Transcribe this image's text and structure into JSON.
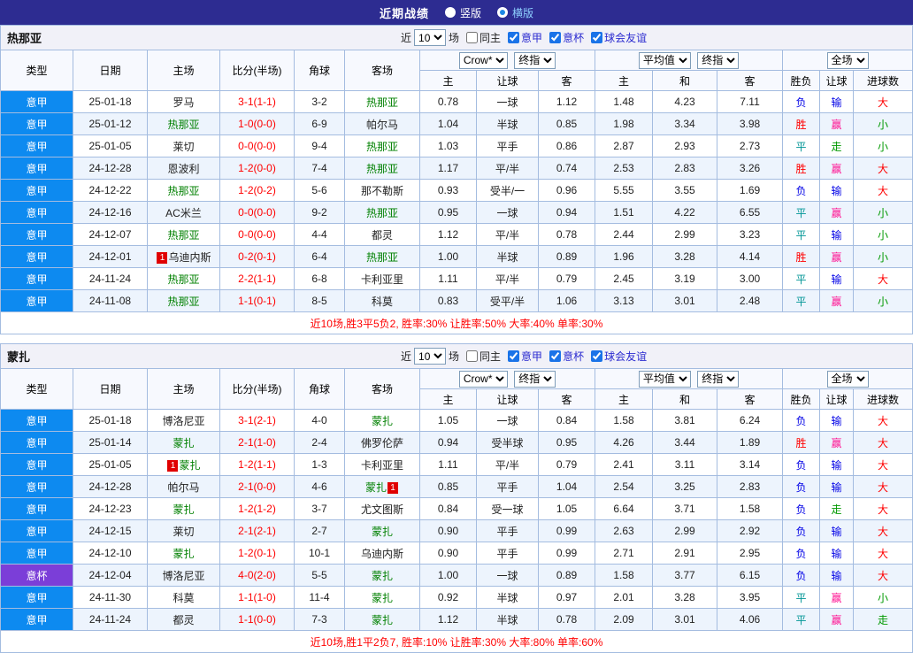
{
  "topbar": {
    "title": "近期战绩",
    "options": [
      {
        "label": "竖版",
        "selected": false
      },
      {
        "label": "横版",
        "selected": true
      }
    ]
  },
  "ui": {
    "recent_label": "近",
    "count_value": "10",
    "matches_label": "场"
  },
  "columns": {
    "type": "类型",
    "date": "日期",
    "home": "主场",
    "score": "比分(半场)",
    "corner": "角球",
    "away": "客场",
    "bookmaker_select": "Crow*",
    "final_select": "终指",
    "average_select": "平均值",
    "fulltime_select": "全场",
    "sub_home1": "主",
    "sub_handicap1": "让球",
    "sub_away1": "客",
    "sub_home2": "主",
    "sub_draw": "和",
    "sub_away2": "客",
    "sub_winlose": "胜负",
    "sub_handicap2": "让球",
    "sub_goals": "进球数"
  },
  "colors": {
    "topbar_bg": "#2d2c91",
    "league_badge_blue": "#0d8af0",
    "cup_badge_purple": "#7b3ed8",
    "tracked_team_green": "#008000",
    "score_red": "#ff0000",
    "win_red": "#ff0000",
    "draw_teal": "#009596",
    "lose_blue": "#0000e6",
    "cover_pink": "#ff1493",
    "push_green": "#009900",
    "summary_red": "#ff0000",
    "grid_border": "#a4bce0"
  },
  "sections": [
    {
      "team": "热那亚",
      "filters": [
        {
          "label": "同主",
          "checked": false
        },
        {
          "label": "意甲",
          "checked": true
        },
        {
          "label": "意杯",
          "checked": true
        },
        {
          "label": "球会友谊",
          "checked": true
        }
      ],
      "rows": [
        {
          "type": "意甲",
          "date": "25-01-18",
          "home": "罗马",
          "home_team": false,
          "score": "3-1(1-1)",
          "corner": "3-2",
          "away": "热那亚",
          "away_team": true,
          "odds1": [
            "0.78",
            "一球",
            "1.12"
          ],
          "odds2": [
            "1.48",
            "4.23",
            "7.11"
          ],
          "result": [
            "负",
            "输",
            "大"
          ]
        },
        {
          "type": "意甲",
          "date": "25-01-12",
          "home": "热那亚",
          "home_team": true,
          "score": "1-0(0-0)",
          "corner": "6-9",
          "away": "帕尔马",
          "away_team": false,
          "odds1": [
            "1.04",
            "半球",
            "0.85"
          ],
          "odds2": [
            "1.98",
            "3.34",
            "3.98"
          ],
          "result": [
            "胜",
            "赢",
            "小"
          ]
        },
        {
          "type": "意甲",
          "date": "25-01-05",
          "home": "莱切",
          "home_team": false,
          "score": "0-0(0-0)",
          "corner": "9-4",
          "away": "热那亚",
          "away_team": true,
          "odds1": [
            "1.03",
            "平手",
            "0.86"
          ],
          "odds2": [
            "2.87",
            "2.93",
            "2.73"
          ],
          "result": [
            "平",
            "走",
            "小"
          ]
        },
        {
          "type": "意甲",
          "date": "24-12-28",
          "home": "恩波利",
          "home_team": false,
          "score": "1-2(0-0)",
          "corner": "7-4",
          "away": "热那亚",
          "away_team": true,
          "odds1": [
            "1.17",
            "平/半",
            "0.74"
          ],
          "odds2": [
            "2.53",
            "2.83",
            "3.26"
          ],
          "result": [
            "胜",
            "赢",
            "大"
          ]
        },
        {
          "type": "意甲",
          "date": "24-12-22",
          "home": "热那亚",
          "home_team": true,
          "score": "1-2(0-2)",
          "corner": "5-6",
          "away": "那不勒斯",
          "away_team": false,
          "odds1": [
            "0.93",
            "受半/一",
            "0.96"
          ],
          "odds2": [
            "5.55",
            "3.55",
            "1.69"
          ],
          "result": [
            "负",
            "输",
            "大"
          ]
        },
        {
          "type": "意甲",
          "date": "24-12-16",
          "home": "AC米兰",
          "home_team": false,
          "score": "0-0(0-0)",
          "corner": "9-2",
          "away": "热那亚",
          "away_team": true,
          "odds1": [
            "0.95",
            "一球",
            "0.94"
          ],
          "odds2": [
            "1.51",
            "4.22",
            "6.55"
          ],
          "result": [
            "平",
            "赢",
            "小"
          ]
        },
        {
          "type": "意甲",
          "date": "24-12-07",
          "home": "热那亚",
          "home_team": true,
          "score": "0-0(0-0)",
          "corner": "4-4",
          "away": "都灵",
          "away_team": false,
          "odds1": [
            "1.12",
            "平/半",
            "0.78"
          ],
          "odds2": [
            "2.44",
            "2.99",
            "3.23"
          ],
          "result": [
            "平",
            "输",
            "小"
          ]
        },
        {
          "type": "意甲",
          "date": "24-12-01",
          "home": "乌迪内斯",
          "home_team": false,
          "home_card": "1",
          "home_card_pos": "before",
          "score": "0-2(0-1)",
          "corner": "6-4",
          "away": "热那亚",
          "away_team": true,
          "odds1": [
            "1.00",
            "半球",
            "0.89"
          ],
          "odds2": [
            "1.96",
            "3.28",
            "4.14"
          ],
          "result": [
            "胜",
            "赢",
            "小"
          ]
        },
        {
          "type": "意甲",
          "date": "24-11-24",
          "home": "热那亚",
          "home_team": true,
          "score": "2-2(1-1)",
          "corner": "6-8",
          "away": "卡利亚里",
          "away_team": false,
          "odds1": [
            "1.11",
            "平/半",
            "0.79"
          ],
          "odds2": [
            "2.45",
            "3.19",
            "3.00"
          ],
          "result": [
            "平",
            "输",
            "大"
          ]
        },
        {
          "type": "意甲",
          "date": "24-11-08",
          "home": "热那亚",
          "home_team": true,
          "score": "1-1(0-1)",
          "corner": "8-5",
          "away": "科莫",
          "away_team": false,
          "odds1": [
            "0.83",
            "受平/半",
            "1.06"
          ],
          "odds2": [
            "3.13",
            "3.01",
            "2.48"
          ],
          "result": [
            "平",
            "赢",
            "小"
          ]
        }
      ],
      "summary": "近10场,胜3平5负2, 胜率:30% 让胜率:50% 大率:40% 单率:30%"
    },
    {
      "team": "蒙扎",
      "filters": [
        {
          "label": "同主",
          "checked": false
        },
        {
          "label": "意甲",
          "checked": true
        },
        {
          "label": "意杯",
          "checked": true
        },
        {
          "label": "球会友谊",
          "checked": true
        }
      ],
      "rows": [
        {
          "type": "意甲",
          "date": "25-01-18",
          "home": "博洛尼亚",
          "home_team": false,
          "score": "3-1(2-1)",
          "corner": "4-0",
          "away": "蒙扎",
          "away_team": true,
          "odds1": [
            "1.05",
            "一球",
            "0.84"
          ],
          "odds2": [
            "1.58",
            "3.81",
            "6.24"
          ],
          "result": [
            "负",
            "输",
            "大"
          ]
        },
        {
          "type": "意甲",
          "date": "25-01-14",
          "home": "蒙扎",
          "home_team": true,
          "score": "2-1(1-0)",
          "corner": "2-4",
          "away": "佛罗伦萨",
          "away_team": false,
          "odds1": [
            "0.94",
            "受半球",
            "0.95"
          ],
          "odds2": [
            "4.26",
            "3.44",
            "1.89"
          ],
          "result": [
            "胜",
            "赢",
            "大"
          ]
        },
        {
          "type": "意甲",
          "date": "25-01-05",
          "home": "蒙扎",
          "home_team": true,
          "home_card": "1",
          "home_card_pos": "before",
          "score": "1-2(1-1)",
          "corner": "1-3",
          "away": "卡利亚里",
          "away_team": false,
          "odds1": [
            "1.11",
            "平/半",
            "0.79"
          ],
          "odds2": [
            "2.41",
            "3.11",
            "3.14"
          ],
          "result": [
            "负",
            "输",
            "大"
          ]
        },
        {
          "type": "意甲",
          "date": "24-12-28",
          "home": "帕尔马",
          "home_team": false,
          "score": "2-1(0-0)",
          "corner": "4-6",
          "away": "蒙扎",
          "away_team": true,
          "away_card": "1",
          "away_card_pos": "after",
          "odds1": [
            "0.85",
            "平手",
            "1.04"
          ],
          "odds2": [
            "2.54",
            "3.25",
            "2.83"
          ],
          "result": [
            "负",
            "输",
            "大"
          ]
        },
        {
          "type": "意甲",
          "date": "24-12-23",
          "home": "蒙扎",
          "home_team": true,
          "score": "1-2(1-2)",
          "corner": "3-7",
          "away": "尤文图斯",
          "away_team": false,
          "odds1": [
            "0.84",
            "受一球",
            "1.05"
          ],
          "odds2": [
            "6.64",
            "3.71",
            "1.58"
          ],
          "result": [
            "负",
            "走",
            "大"
          ]
        },
        {
          "type": "意甲",
          "date": "24-12-15",
          "home": "莱切",
          "home_team": false,
          "score": "2-1(2-1)",
          "corner": "2-7",
          "away": "蒙扎",
          "away_team": true,
          "odds1": [
            "0.90",
            "平手",
            "0.99"
          ],
          "odds2": [
            "2.63",
            "2.99",
            "2.92"
          ],
          "result": [
            "负",
            "输",
            "大"
          ]
        },
        {
          "type": "意甲",
          "date": "24-12-10",
          "home": "蒙扎",
          "home_team": true,
          "score": "1-2(0-1)",
          "corner": "10-1",
          "away": "乌迪内斯",
          "away_team": false,
          "odds1": [
            "0.90",
            "平手",
            "0.99"
          ],
          "odds2": [
            "2.71",
            "2.91",
            "2.95"
          ],
          "result": [
            "负",
            "输",
            "大"
          ]
        },
        {
          "type": "意杯",
          "date": "24-12-04",
          "home": "博洛尼亚",
          "home_team": false,
          "score": "4-0(2-0)",
          "corner": "5-5",
          "away": "蒙扎",
          "away_team": true,
          "odds1": [
            "1.00",
            "一球",
            "0.89"
          ],
          "odds2": [
            "1.58",
            "3.77",
            "6.15"
          ],
          "result": [
            "负",
            "输",
            "大"
          ]
        },
        {
          "type": "意甲",
          "date": "24-11-30",
          "home": "科莫",
          "home_team": false,
          "score": "1-1(1-0)",
          "corner": "11-4",
          "away": "蒙扎",
          "away_team": true,
          "odds1": [
            "0.92",
            "半球",
            "0.97"
          ],
          "odds2": [
            "2.01",
            "3.28",
            "3.95"
          ],
          "result": [
            "平",
            "赢",
            "小"
          ]
        },
        {
          "type": "意甲",
          "date": "24-11-24",
          "home": "都灵",
          "home_team": false,
          "score": "1-1(0-0)",
          "corner": "7-3",
          "away": "蒙扎",
          "away_team": true,
          "odds1": [
            "1.12",
            "半球",
            "0.78"
          ],
          "odds2": [
            "2.09",
            "3.01",
            "4.06"
          ],
          "result": [
            "平",
            "赢",
            "走"
          ]
        }
      ],
      "summary": "近10场,胜1平2负7, 胜率:10% 让胜率:30% 大率:80% 单率:60%"
    }
  ]
}
